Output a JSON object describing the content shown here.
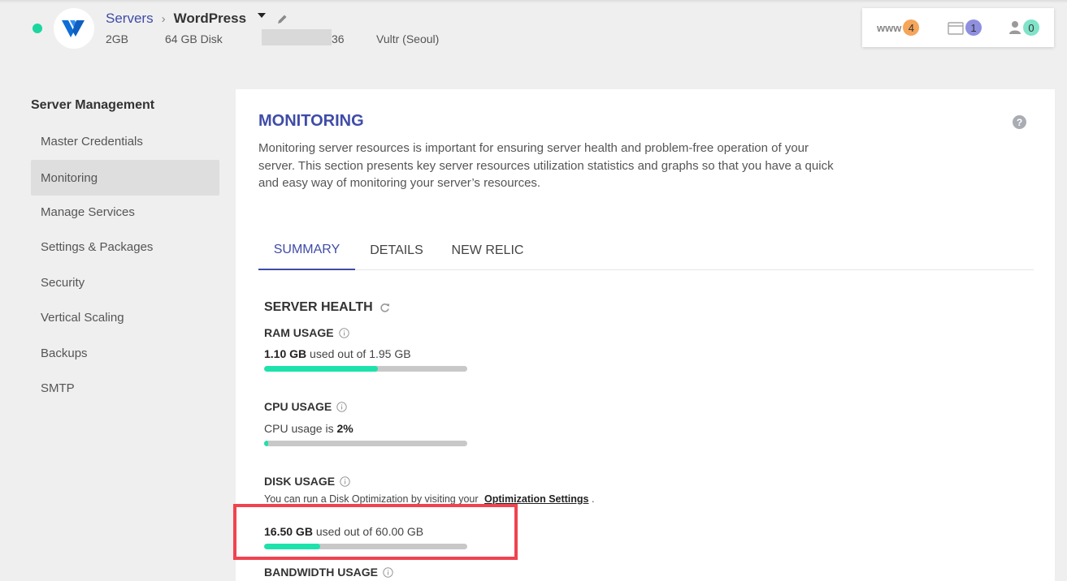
{
  "header": {
    "breadcrumb_parent": "Servers",
    "breadcrumb_current": "WordPress",
    "meta": {
      "ram": "2GB",
      "disk": "64 GB Disk",
      "ip_suffix": "36",
      "provider": "Vultr (Seoul)"
    },
    "counters": {
      "www_label": "www",
      "www_count": "4",
      "files_count": "1",
      "users_count": "0"
    }
  },
  "sidebar": {
    "title": "Server Management",
    "items": [
      {
        "label": "Master Credentials"
      },
      {
        "label": "Monitoring"
      },
      {
        "label": "Manage Services"
      },
      {
        "label": "Settings & Packages"
      },
      {
        "label": "Security"
      },
      {
        "label": "Vertical Scaling"
      },
      {
        "label": "Backups"
      },
      {
        "label": "SMTP"
      }
    ]
  },
  "main": {
    "title": "MONITORING",
    "help": "?",
    "description": "Monitoring server resources is important for ensuring server health and problem-free operation of your server. This section presents key server resources utilization statistics and graphs so that you have a quick and easy way of monitoring your server’s resources.",
    "tabs": [
      {
        "label": "SUMMARY"
      },
      {
        "label": "DETAILS"
      },
      {
        "label": "NEW RELIC"
      }
    ],
    "health": {
      "title": "SERVER HEALTH",
      "ram": {
        "label": "RAM USAGE",
        "used": "1.10 GB",
        "text": " used out of 1.95 GB",
        "fraction": 0.56
      },
      "cpu": {
        "label": "CPU USAGE",
        "text": "CPU usage is ",
        "value": "2%",
        "fraction": 0.02
      },
      "disk": {
        "label": "DISK USAGE",
        "note": "You can run a Disk Optimization by visiting your ",
        "note_link": "Optimization Settings",
        "note_end": " .",
        "used": "16.50 GB",
        "text": " used out of 60.00 GB",
        "fraction": 0.275
      },
      "bandwidth": {
        "label": "BANDWIDTH USAGE"
      }
    }
  },
  "colors": {
    "accent": "#3f4ca7",
    "bar_fill": "#1de2ac",
    "highlight": "#f0434f"
  }
}
